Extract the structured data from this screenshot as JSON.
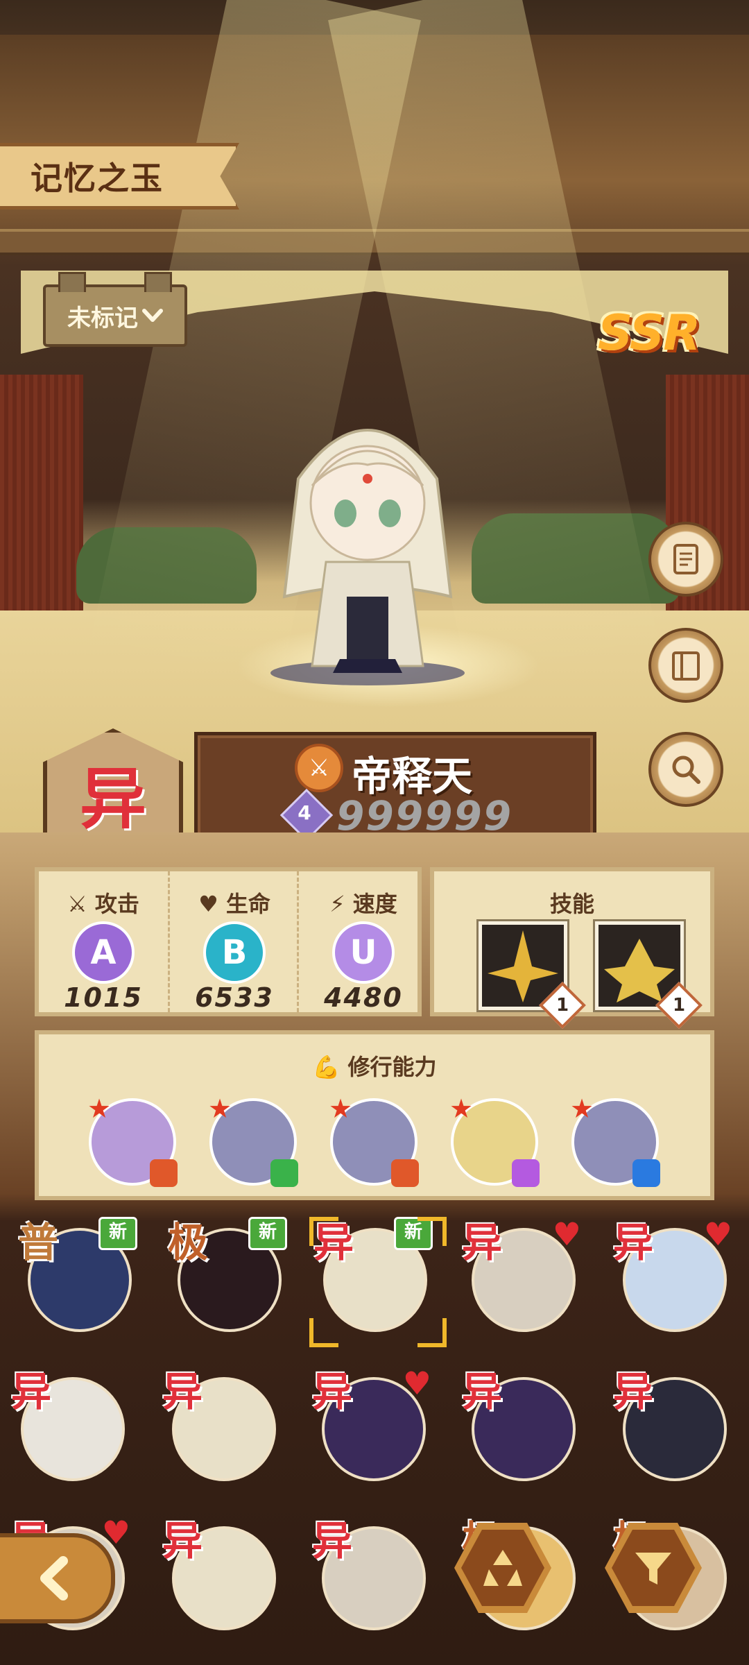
{
  "title": "记忆之玉",
  "mark_filter": {
    "label": "未标记"
  },
  "rarity": "SSR",
  "character": {
    "placard_rank": "异",
    "name": "帝释天",
    "level": "4",
    "number": "999999"
  },
  "stats": [
    {
      "label": "攻击",
      "grade": "A",
      "value": "1015",
      "color": "#9a6ad6",
      "icon": "crossed-swords-icon"
    },
    {
      "label": "生命",
      "grade": "B",
      "value": "6533",
      "color": "#2ab3c9",
      "icon": "heart-icon"
    },
    {
      "label": "速度",
      "grade": "U",
      "value": "4480",
      "color": "#b48ce6",
      "icon": "lightning-icon"
    }
  ],
  "skills": {
    "label": "技能",
    "items": [
      {
        "name": "skill-1",
        "level": "1"
      },
      {
        "name": "skill-2",
        "level": "1"
      }
    ]
  },
  "practice": {
    "label": "修行能力",
    "items": [
      {
        "bg": "#b79bd9",
        "mark": "#e0582a"
      },
      {
        "bg": "#8f8fb8",
        "mark": "#3ab24a"
      },
      {
        "bg": "#8f8fb8",
        "mark": "#e0582a"
      },
      {
        "bg": "#e8d48a",
        "mark": "#b45ae0"
      },
      {
        "bg": "#8f8fb8",
        "mark": "#2a7ae0"
      }
    ]
  },
  "roster": [
    {
      "rank": "普",
      "rank_color": "#c07a3a",
      "tag": "新",
      "bg": "#2d3a6a"
    },
    {
      "rank": "极",
      "rank_color": "#c0602a",
      "tag": "新",
      "bg": "#2a1a1e"
    },
    {
      "rank": "异",
      "rank_color": "#e0303a",
      "tag": "新",
      "bg": "#e8e0c8"
    },
    {
      "rank": "异",
      "rank_color": "#e0303a",
      "tag": "",
      "bg": "#d8cfc0"
    },
    {
      "rank": "异",
      "rank_color": "#e0303a",
      "tag": "",
      "bg": "#c8d8ec"
    },
    {
      "rank": "异",
      "rank_color": "#e0303a",
      "tag": "",
      "bg": "#e8e4dc"
    },
    {
      "rank": "异",
      "rank_color": "#e0303a",
      "tag": "",
      "bg": "#e8e0c8"
    },
    {
      "rank": "异",
      "rank_color": "#e0303a",
      "tag": "",
      "bg": "#3a2a5a"
    },
    {
      "rank": "异",
      "rank_color": "#e0303a",
      "tag": "",
      "bg": "#3a2a5a"
    },
    {
      "rank": "异",
      "rank_color": "#e0303a",
      "tag": "",
      "bg": "#2a2a3a"
    },
    {
      "rank": "异",
      "rank_color": "#e0303a",
      "tag": "",
      "bg": "#d8cfc0"
    },
    {
      "rank": "异",
      "rank_color": "#e0303a",
      "tag": "",
      "bg": "#e8e0c8"
    },
    {
      "rank": "异",
      "rank_color": "#e0303a",
      "tag": "",
      "bg": "#d8cfc0"
    },
    {
      "rank": "极",
      "rank_color": "#c0602a",
      "tag": "",
      "bg": "#e8c070"
    },
    {
      "rank": "极",
      "rank_color": "#c0602a",
      "tag": "",
      "bg": "#d8c0a0"
    }
  ],
  "colors": {
    "accent": "#c98a3a",
    "selection": "#f0b82a",
    "new_tag": "#4aa83a"
  }
}
